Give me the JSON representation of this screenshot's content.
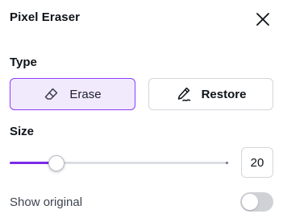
{
  "panel": {
    "title": "Pixel Eraser",
    "close_icon": "close-icon"
  },
  "type_section": {
    "label": "Type",
    "options": [
      {
        "label": "Erase",
        "icon": "eraser-icon",
        "selected": true
      },
      {
        "label": "Restore",
        "icon": "pen-restore-icon",
        "selected": false
      }
    ]
  },
  "size_section": {
    "label": "Size",
    "value": "20",
    "slider_fraction": 0.21
  },
  "show_original": {
    "label": "Show original",
    "enabled": false
  },
  "colors": {
    "accent": "#7d2ae8",
    "selected_bg": "#f0eafc",
    "selected_border": "#8b3dff",
    "toggle_off": "#cfd1d6"
  }
}
